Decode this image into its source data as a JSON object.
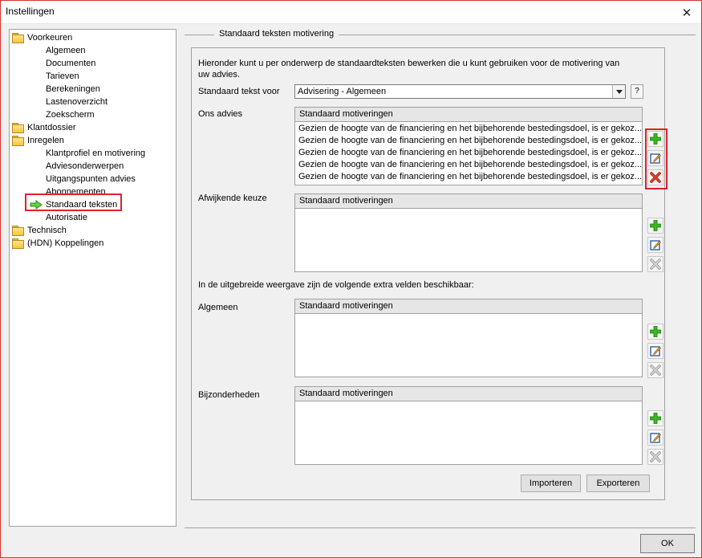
{
  "window": {
    "title": "Instellingen"
  },
  "tree": {
    "items": [
      {
        "label": "Voorkeuren",
        "type": "folder",
        "level": 0
      },
      {
        "label": "Algemeen",
        "type": "leaf",
        "level": 1
      },
      {
        "label": "Documenten",
        "type": "leaf",
        "level": 1
      },
      {
        "label": "Tarieven",
        "type": "leaf",
        "level": 1
      },
      {
        "label": "Berekeningen",
        "type": "leaf",
        "level": 1
      },
      {
        "label": "Lastenoverzicht",
        "type": "leaf",
        "level": 1
      },
      {
        "label": "Zoekscherm",
        "type": "leaf",
        "level": 1
      },
      {
        "label": "Klantdossier",
        "type": "folder",
        "level": 0
      },
      {
        "label": "Inregelen",
        "type": "folder",
        "level": 0
      },
      {
        "label": "Klantprofiel en motivering",
        "type": "leaf",
        "level": 1
      },
      {
        "label": "Adviesonderwerpen",
        "type": "leaf",
        "level": 1
      },
      {
        "label": "Uitgangspunten advies",
        "type": "leaf",
        "level": 1
      },
      {
        "label": "Abonnementen",
        "type": "leaf",
        "level": 1
      },
      {
        "label": "Standaard teksten",
        "type": "selected",
        "level": 1
      },
      {
        "label": "Autorisatie",
        "type": "leaf",
        "level": 1
      },
      {
        "label": "Technisch",
        "type": "folder",
        "level": 0
      },
      {
        "label": "(HDN) Koppelingen",
        "type": "folder",
        "level": 0
      }
    ]
  },
  "main": {
    "section_title": "Standaard teksten motivering",
    "description": "Hieronder kunt u per onderwerp de standaardteksten bewerken die u kunt gebruiken voor de motivering van uw advies.",
    "standaard_label": "Standaard tekst voor",
    "combo_value": "Advisering - Algemeen",
    "help_label": "?",
    "ons_advies_label": "Ons advies",
    "afwijkende_label": "Afwijkende keuze",
    "extended_note": "In de uitgebreide weergave zijn de volgende extra velden beschikbaar:",
    "algemeen_label": "Algemeen",
    "bijzonderheden_label": "Bijzonderheden",
    "list_header": "Standaard motiveringen",
    "ons_advies_rows": [
      "Gezien de hoogte van de financiering en het bijbehorende bestedingsdoel, is er gekoz...",
      "Gezien de hoogte van de financiering en het bijbehorende bestedingsdoel, is er gekoz...",
      "Gezien de hoogte van de financiering en het bijbehorende bestedingsdoel, is er gekoz...",
      "Gezien de hoogte van de financiering en het bijbehorende bestedingsdoel, is er gekoz...",
      "Gezien de hoogte van de financiering en het bijbehorende bestedingsdoel, is er gekoz..."
    ],
    "importeren_label": "Importeren",
    "exporteren_label": "Exporteren",
    "ok_label": "OK"
  },
  "colors": {
    "accent_red": "#e0202c",
    "add_green": "#2da01e",
    "delete_red": "#d42a1a"
  },
  "icons": [
    "folder-icon",
    "arrow-right-icon",
    "add-icon",
    "edit-icon",
    "delete-icon",
    "close-icon",
    "dropdown-arrow-icon"
  ]
}
